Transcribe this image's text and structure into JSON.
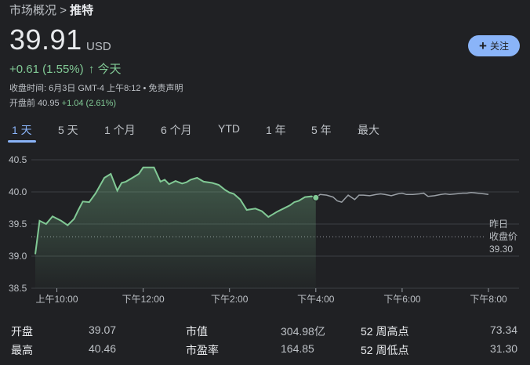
{
  "breadcrumb": {
    "parent": "市场概况",
    "separator": ">",
    "current": "推特"
  },
  "quote": {
    "price": "39.91",
    "currency": "USD",
    "change": "+0.61 (1.55%)",
    "change_arrow": "↑",
    "change_period": "今天",
    "close_info": "收盘时间: 6月3日 GMT-4 上午8:12 • 免责声明",
    "premarket_label": "开盘前 40.95",
    "premarket_change": "+1.04 (2.61%)"
  },
  "follow": {
    "icon": "plus-icon",
    "label": "关注"
  },
  "tabs": [
    "1 天",
    "5 天",
    "1 个月",
    "6 个月",
    "YTD",
    "1 年",
    "5 年",
    "最大"
  ],
  "colors": {
    "accent": "#8ab4f8",
    "positive": "#81c995",
    "afterhours": "#9aa0a6",
    "background": "#202124"
  },
  "chart_data": {
    "type": "line",
    "ylim": [
      38.5,
      40.5
    ],
    "yticks": [
      "40.5",
      "40.0",
      "39.5",
      "39.0",
      "38.5"
    ],
    "xticks": [
      "上午10:00",
      "下午12:00",
      "下午2:00",
      "下午4:00",
      "下午6:00",
      "下午8:00"
    ],
    "previous_close": {
      "label_line1": "昨日",
      "label_line2": "收盘价",
      "value": 39.3
    },
    "regular_hours": {
      "x": [
        9.5,
        9.6,
        9.75,
        9.9,
        10.1,
        10.25,
        10.4,
        10.5,
        10.6,
        10.75,
        10.9,
        11.1,
        11.25,
        11.4,
        11.5,
        11.6,
        11.75,
        11.9,
        12.0,
        12.1,
        12.25,
        12.4,
        12.5,
        12.6,
        12.75,
        12.9,
        13.0,
        13.1,
        13.25,
        13.4,
        13.6,
        13.75,
        13.9,
        14.0,
        14.1,
        14.25,
        14.4,
        14.6,
        14.75,
        14.9,
        15.0,
        15.1,
        15.25,
        15.4,
        15.5,
        15.6,
        15.75,
        15.9,
        16.0
      ],
      "y": [
        39.03,
        39.55,
        39.5,
        39.62,
        39.55,
        39.48,
        39.58,
        39.72,
        39.85,
        39.84,
        39.98,
        40.22,
        40.28,
        40.02,
        40.14,
        40.16,
        40.22,
        40.28,
        40.38,
        40.38,
        40.38,
        40.16,
        40.19,
        40.12,
        40.17,
        40.13,
        40.15,
        40.19,
        40.22,
        40.16,
        40.14,
        40.11,
        40.03,
        39.99,
        39.97,
        39.88,
        39.72,
        39.74,
        39.7,
        39.61,
        39.65,
        39.69,
        39.74,
        39.79,
        39.84,
        39.86,
        39.92,
        39.93,
        39.91
      ]
    },
    "after_hours": {
      "x": [
        16.0,
        16.1,
        16.25,
        16.4,
        16.5,
        16.6,
        16.75,
        16.9,
        17.0,
        17.1,
        17.25,
        17.4,
        17.5,
        17.6,
        17.75,
        17.9,
        18.0,
        18.1,
        18.25,
        18.4,
        18.5,
        18.6,
        18.75,
        18.9,
        19.0,
        19.1,
        19.25,
        19.4,
        19.5,
        19.6,
        19.75,
        19.9,
        20.0
      ],
      "y": [
        39.91,
        39.96,
        39.95,
        39.92,
        39.86,
        39.84,
        39.95,
        39.88,
        39.95,
        39.95,
        39.94,
        39.96,
        39.97,
        39.96,
        39.94,
        39.97,
        39.98,
        39.96,
        39.96,
        39.97,
        39.98,
        39.93,
        39.94,
        39.96,
        39.97,
        39.96,
        39.97,
        39.98,
        39.98,
        39.99,
        39.98,
        39.97,
        39.96
      ]
    }
  },
  "stats": [
    {
      "label": "开盘",
      "value": "39.07"
    },
    {
      "label": "最高",
      "value": "40.46"
    },
    {
      "label": "市值",
      "value": "304.98亿"
    },
    {
      "label": "市盈率",
      "value": "164.85"
    },
    {
      "label": "52 周高点",
      "value": "73.34"
    },
    {
      "label": "52 周低点",
      "value": "31.30"
    }
  ]
}
